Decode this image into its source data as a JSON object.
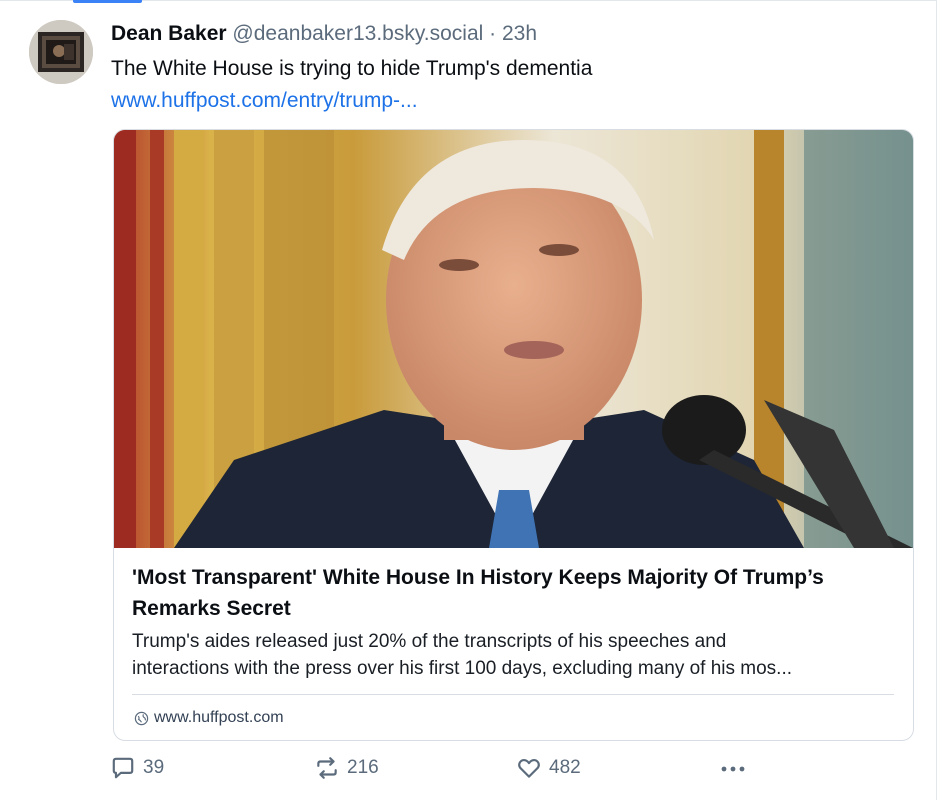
{
  "post": {
    "author_name": "Dean Baker",
    "author_handle": "@deanbaker13.bsky.social",
    "separator": "·",
    "time": "23h",
    "text": "The White House is trying to hide Trump's dementia",
    "link_text": "www.huffpost.com/entry/trump-..."
  },
  "card": {
    "title": "'Most Transparent' White House In History Keeps Majority Of Trump’s Remarks Secret",
    "description_line1": "Trump's aides released just 20% of the transcripts of his speeches and",
    "description_line2": "interactions with the press over his first 100 days, excluding many of his mos...",
    "domain": "www.huffpost.com",
    "domain_icon": "globe-icon"
  },
  "actions": {
    "reply_count": "39",
    "repost_count": "216",
    "like_count": "482",
    "reply_icon": "reply-icon",
    "repost_icon": "repost-icon",
    "like_icon": "heart-icon",
    "more_icon": "more-icon"
  },
  "colors": {
    "link": "#1d72e8",
    "muted": "#5b6b7c",
    "accent_tab": "#3b82f6"
  }
}
